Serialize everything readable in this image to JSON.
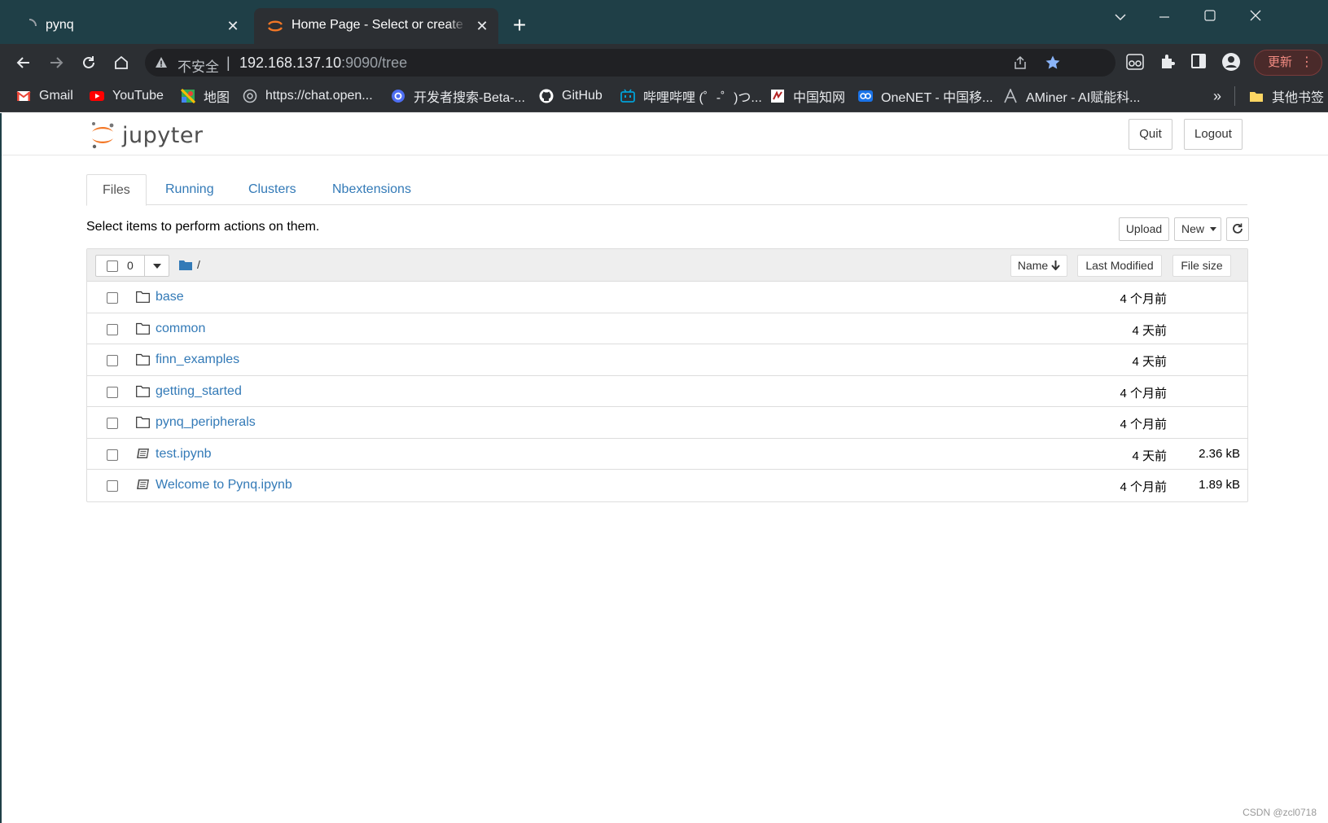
{
  "browser": {
    "tabs": [
      {
        "title": "pynq",
        "active": false
      },
      {
        "title": "Home Page - Select or create a notebook",
        "active": true
      }
    ],
    "address": {
      "security_label": "不安全",
      "host": "192.168.137.10",
      "rest": ":9090/tree"
    },
    "update_label": "更新",
    "bookmarks": [
      {
        "label": "Gmail",
        "icon": "gmail-icon",
        "color": "#ea4335"
      },
      {
        "label": "YouTube",
        "icon": "youtube-icon",
        "color": "#ff0000"
      },
      {
        "label": "地图",
        "icon": "maps-icon",
        "color": "#34a853"
      },
      {
        "label": "https://chat.open...",
        "icon": "openai-icon",
        "color": "#bdc1c6"
      },
      {
        "label": "开发者搜索-Beta-...",
        "icon": "devsearch-icon",
        "color": "#4e6ef2"
      },
      {
        "label": "GitHub",
        "icon": "github-icon",
        "color": "#ffffff"
      },
      {
        "label": "哔哩哔哩 (゜-゜)つ...",
        "icon": "bilibili-icon",
        "color": "#00a1d6"
      },
      {
        "label": "中国知网",
        "icon": "cnki-icon",
        "color": "#ffffff"
      },
      {
        "label": "OneNET - 中国移...",
        "icon": "onenet-icon",
        "color": "#1a73e8"
      },
      {
        "label": "AMiner - AI赋能科...",
        "icon": "aminer-icon",
        "color": "#bdc1c6"
      }
    ],
    "more_bookmarks_label": "»",
    "other_bookmarks_label": "其他书签"
  },
  "jupyter": {
    "logo_text": "jupyter",
    "quit_label": "Quit",
    "logout_label": "Logout",
    "tabs": [
      "Files",
      "Running",
      "Clusters",
      "Nbextensions"
    ],
    "hint": "Select items to perform actions on them.",
    "upload_label": "Upload",
    "new_label": "New",
    "selected_count": "0",
    "breadcrumb": "/",
    "columns": {
      "name": "Name",
      "last_modified": "Last Modified",
      "file_size": "File size"
    },
    "files": [
      {
        "name": "base",
        "type": "folder",
        "modified": "4 个月前",
        "size": ""
      },
      {
        "name": "common",
        "type": "folder",
        "modified": "4 天前",
        "size": ""
      },
      {
        "name": "finn_examples",
        "type": "folder",
        "modified": "4 天前",
        "size": ""
      },
      {
        "name": "getting_started",
        "type": "folder",
        "modified": "4 个月前",
        "size": ""
      },
      {
        "name": "pynq_peripherals",
        "type": "folder",
        "modified": "4 个月前",
        "size": ""
      },
      {
        "name": "test.ipynb",
        "type": "notebook",
        "modified": "4 天前",
        "size": "2.36 kB"
      },
      {
        "name": "Welcome to Pynq.ipynb",
        "type": "notebook",
        "modified": "4 个月前",
        "size": "1.89 kB"
      }
    ]
  },
  "watermark": "CSDN @zcl0718",
  "colors": {
    "titlebar": "#1f3f47",
    "chrome": "#2c2f33",
    "link": "#337ab7",
    "jupyter_orange": "#f37726"
  }
}
